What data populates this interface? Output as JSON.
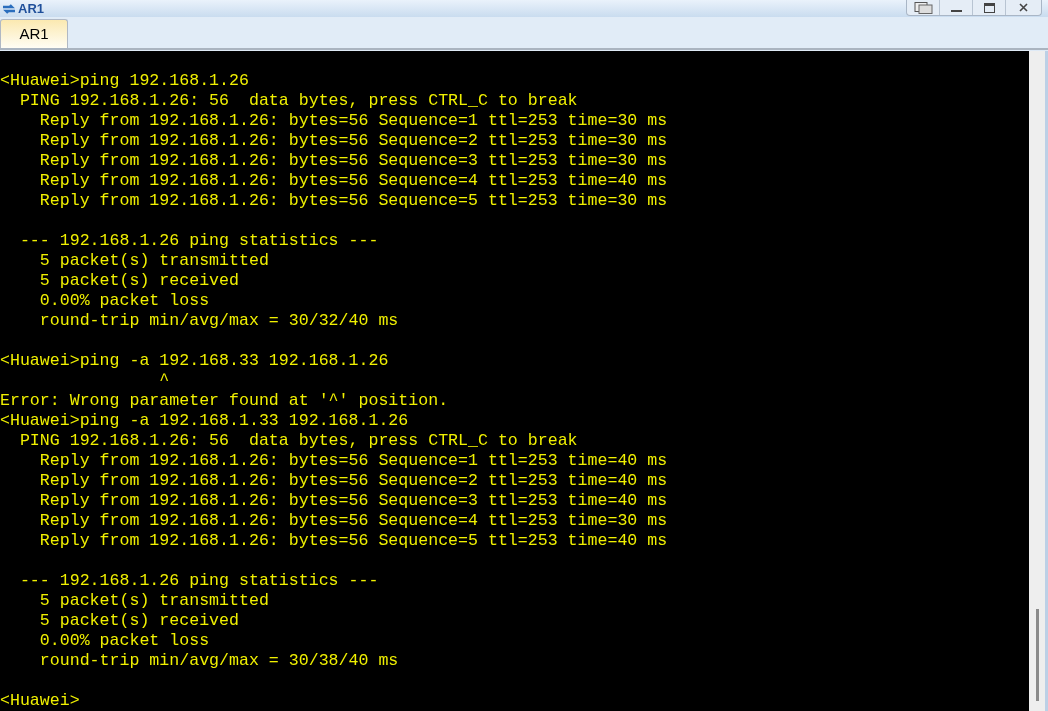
{
  "window": {
    "title": "AR1"
  },
  "tabs": [
    {
      "label": "AR1",
      "selected": true
    }
  ],
  "terminal": {
    "blocks": [
      [
        "<Huawei>ping 192.168.1.26",
        "  PING 192.168.1.26: 56  data bytes, press CTRL_C to break",
        "    Reply from 192.168.1.26: bytes=56 Sequence=1 ttl=253 time=30 ms",
        "    Reply from 192.168.1.26: bytes=56 Sequence=2 ttl=253 time=30 ms",
        "    Reply from 192.168.1.26: bytes=56 Sequence=3 ttl=253 time=30 ms",
        "    Reply from 192.168.1.26: bytes=56 Sequence=4 ttl=253 time=40 ms",
        "    Reply from 192.168.1.26: bytes=56 Sequence=5 ttl=253 time=30 ms"
      ],
      [
        "  --- 192.168.1.26 ping statistics ---",
        "    5 packet(s) transmitted",
        "    5 packet(s) received",
        "    0.00% packet loss",
        "    round-trip min/avg/max = 30/32/40 ms"
      ],
      [
        "<Huawei>ping -a 192.168.33 192.168.1.26",
        "                ^",
        "Error: Wrong parameter found at '^' position.",
        "<Huawei>ping -a 192.168.1.33 192.168.1.26",
        "  PING 192.168.1.26: 56  data bytes, press CTRL_C to break",
        "    Reply from 192.168.1.26: bytes=56 Sequence=1 ttl=253 time=40 ms",
        "    Reply from 192.168.1.26: bytes=56 Sequence=2 ttl=253 time=40 ms",
        "    Reply from 192.168.1.26: bytes=56 Sequence=3 ttl=253 time=40 ms",
        "    Reply from 192.168.1.26: bytes=56 Sequence=4 ttl=253 time=30 ms",
        "    Reply from 192.168.1.26: bytes=56 Sequence=5 ttl=253 time=40 ms"
      ],
      [
        "  --- 192.168.1.26 ping statistics ---",
        "    5 packet(s) transmitted",
        "    5 packet(s) received",
        "    0.00% packet loss",
        "    round-trip min/avg/max = 30/38/40 ms"
      ],
      [
        "<Huawei>"
      ]
    ]
  }
}
